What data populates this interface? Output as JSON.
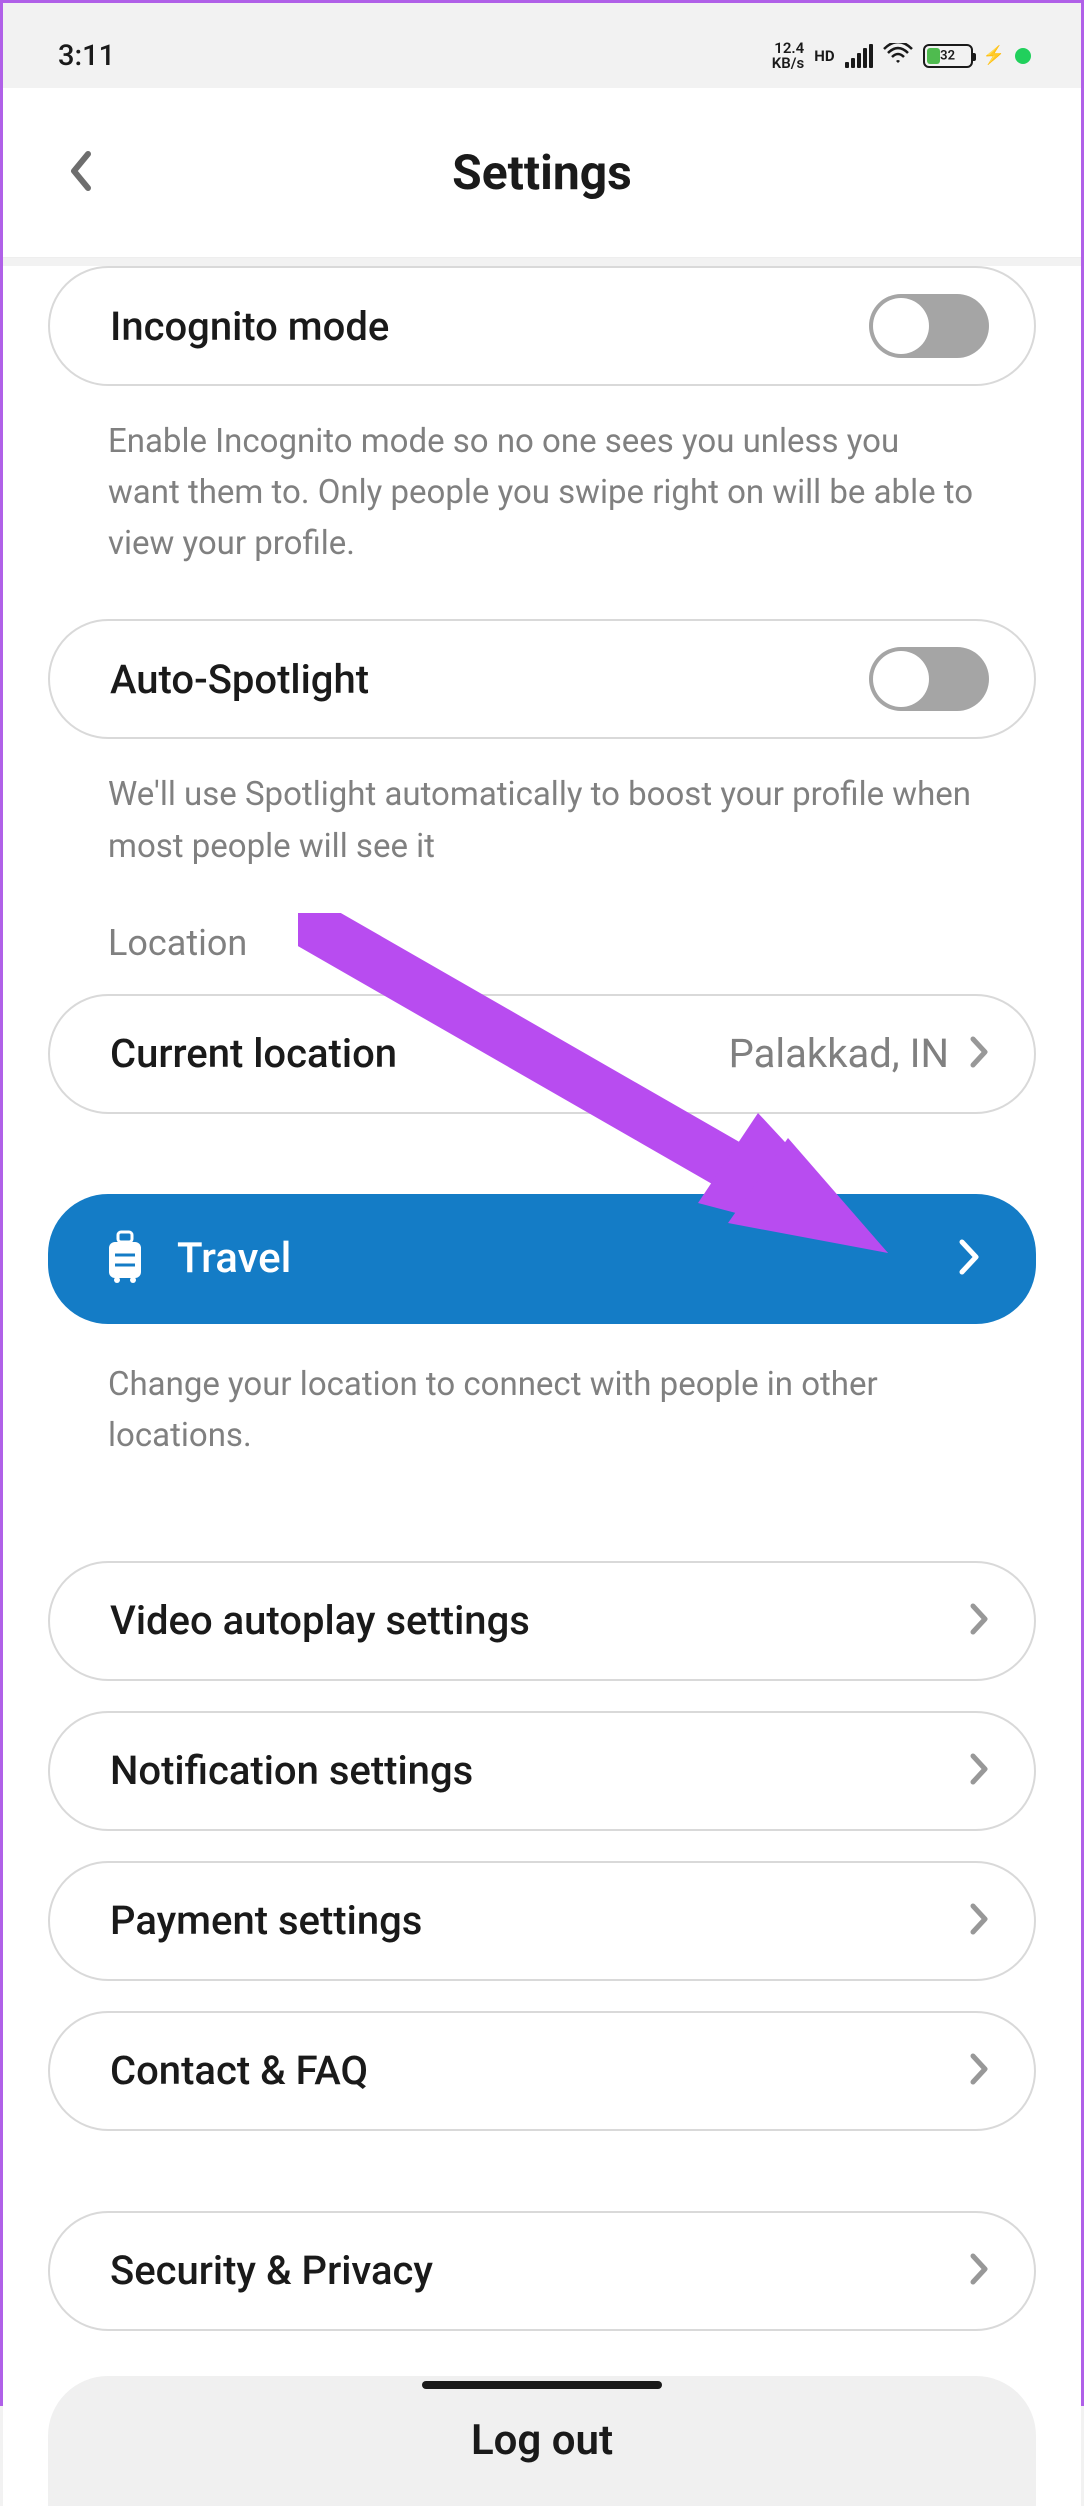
{
  "status_bar": {
    "time": "3:11",
    "speed": "12.4",
    "speed_unit": "KB/s",
    "hd": "HD",
    "battery": "32"
  },
  "header": {
    "title": "Settings"
  },
  "incognito": {
    "label": "Incognito mode",
    "help": "Enable Incognito mode so no one sees you unless you want them to. Only people you swipe right on will be able to view your profile."
  },
  "spotlight": {
    "label": "Auto-Spotlight",
    "help": "We'll use Spotlight automatically to boost your profile when most people will see it"
  },
  "location": {
    "section_label": "Location",
    "current_label": "Current location",
    "current_value": "Palakkad, IN",
    "travel_label": "Travel",
    "travel_help": "Change your location to connect with people in other locations."
  },
  "nav": {
    "video": "Video autoplay settings",
    "notification": "Notification settings",
    "payment": "Payment settings",
    "contact": "Contact & FAQ",
    "security": "Security & Privacy"
  },
  "logout": {
    "label": "Log out"
  }
}
